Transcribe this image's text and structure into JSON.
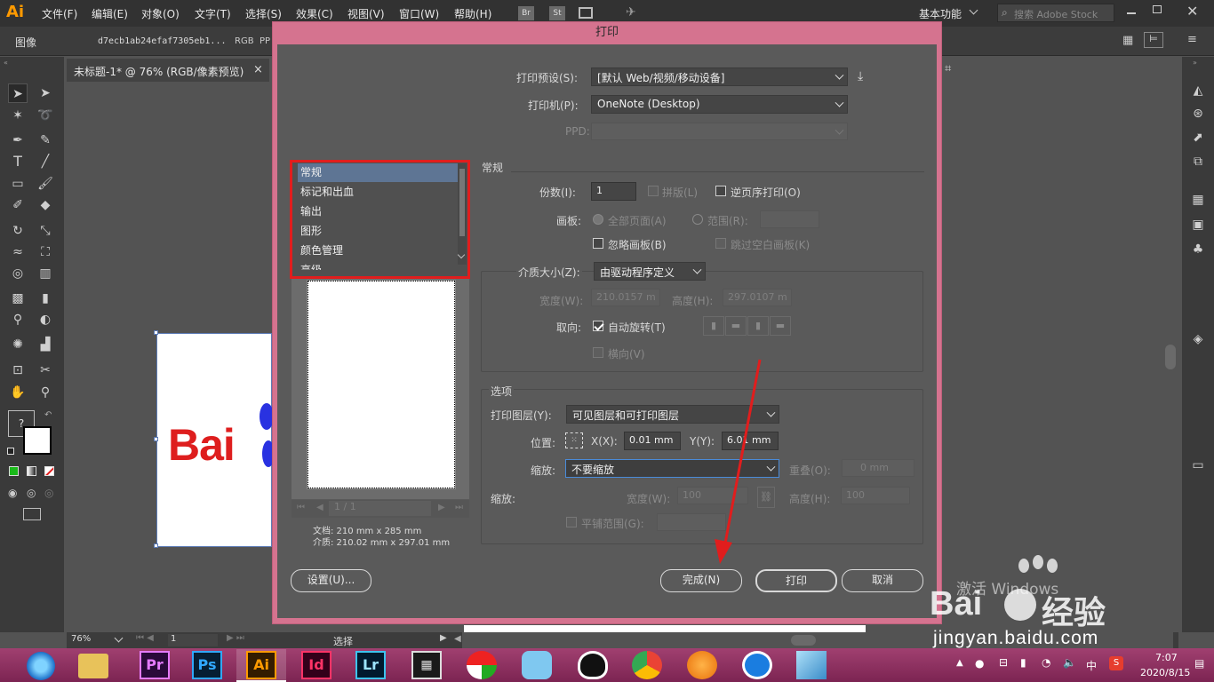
{
  "app": {
    "logo": "Ai"
  },
  "menubar": {
    "items": [
      "文件(F)",
      "编辑(E)",
      "对象(O)",
      "文字(T)",
      "选择(S)",
      "效果(C)",
      "视图(V)",
      "窗口(W)",
      "帮助(H)"
    ],
    "bridge_label": "Br",
    "stock_label": "St",
    "workspace": "基本功能",
    "search_placeholder": "搜索 Adobe Stock"
  },
  "controlbar": {
    "object_type": "图像",
    "filename": "d7ecb1ab24efaf7305eb1...",
    "color_mode": "RGB",
    "ppi_label": "PP"
  },
  "document_tab": {
    "title": "未标题-1* @ 76% (RGB/像素预览)",
    "close": "×"
  },
  "canvas": {
    "logo_text": "Bai"
  },
  "statusbar": {
    "zoom": "76%",
    "artboard": "1",
    "mode": "选择"
  },
  "dialog": {
    "title": "打印",
    "preset_label": "打印预设(S):",
    "preset_value": "[默认 Web/视频/移动设备]",
    "printer_label": "打印机(P):",
    "printer_value": "OneNote (Desktop)",
    "ppd_label": "PPD:",
    "categories": [
      "常规",
      "标记和出血",
      "输出",
      "图形",
      "颜色管理",
      "高级"
    ],
    "selected_category": "常规",
    "page_nav": "1 / 1",
    "doc_size": "文档: 210 mm x 285 mm",
    "media_size": "介质: 210.02 mm x 297.01 mm",
    "general": {
      "heading": "常规",
      "copies_label": "份数(I):",
      "copies_value": "1",
      "collate_label": "拼版(L)",
      "reverse_label": "逆页序打印(O)",
      "artboard_label": "画板:",
      "all_pages_label": "全部页面(A)",
      "range_label": "范围(R):",
      "ignore_artboards_label": "忽略画板(B)",
      "skip_blank_label": "跳过空白画板(K)",
      "media_label": "介质大小(Z):",
      "media_value": "由驱动程序定义",
      "width_label": "宽度(W):",
      "width_value": "210.0157 m",
      "height_label": "高度(H):",
      "height_value": "297.0107 m",
      "orientation_label": "取向:",
      "auto_rotate_label": "自动旋转(T)",
      "auto_rotate_checked": true,
      "transverse_label": "横向(V)"
    },
    "options": {
      "heading": "选项",
      "layers_label": "打印图层(Y):",
      "layers_value": "可见图层和可打印图层",
      "position_label": "位置:",
      "x_label": "X(X):",
      "x_value": "0.01 mm",
      "y_label": "Y(Y):",
      "y_value": "6.01 mm",
      "scale_label": "缩放:",
      "scale_value": "不要缩放",
      "overlap_label": "重叠(O):",
      "overlap_value": "0 mm",
      "scale2_label": "缩放:",
      "scale_w_label": "宽度(W):",
      "scale_w_value": "100",
      "scale_h_label": "高度(H):",
      "scale_h_value": "100",
      "tile_label": "平铺范围(G):"
    },
    "buttons": {
      "setup": "设置(U)...",
      "done": "完成(N)",
      "print": "打印",
      "cancel": "取消"
    }
  },
  "taskbar": {
    "apps": [
      "Pr",
      "Ps",
      "Ai",
      "Id",
      "Lr"
    ],
    "ime": "中",
    "time": "7:07",
    "date": "2020/8/15"
  },
  "watermark": {
    "line1": "激活 Windows",
    "brand": "Bai",
    "brand2": "经验",
    "url": "jingyan.baidu.com"
  },
  "colors": {
    "accent_red": "#e11d1d",
    "dialog_frame": "#d5738f",
    "taskbar": "#8a2c5e",
    "ai_orange": "#ff9a00"
  }
}
